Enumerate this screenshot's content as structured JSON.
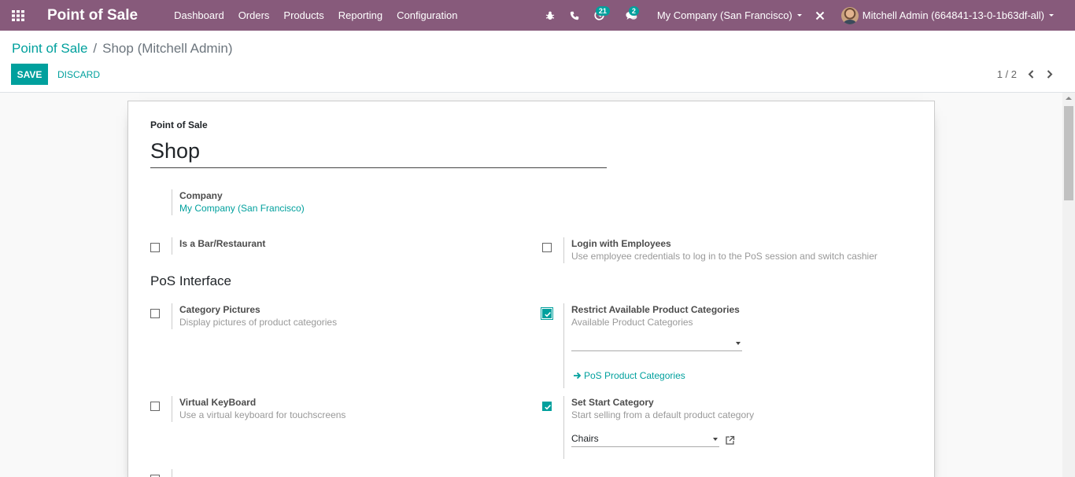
{
  "navbar": {
    "brand": "Point of Sale",
    "menu": [
      "Dashboard",
      "Orders",
      "Products",
      "Reporting",
      "Configuration"
    ],
    "activity_count": "21",
    "messages_count": "2",
    "company": "My Company (San Francisco)",
    "user": "Mitchell Admin (664841-13-0-1b63df-all)",
    "bg_color": "#875a7b"
  },
  "breadcrumb": {
    "parent": "Point of Sale",
    "separator": "/",
    "current": "Shop (Mitchell Admin)"
  },
  "toolbar": {
    "save": "SAVE",
    "discard": "DISCARD",
    "pager": "1 / 2"
  },
  "form": {
    "name_label": "Point of Sale",
    "name_value": "Shop",
    "company_label": "Company",
    "company_value": "My Company (San Francisco)",
    "is_bar": {
      "title": "Is a Bar/Restaurant",
      "checked": false
    },
    "login_employees": {
      "title": "Login with Employees",
      "desc": "Use employee credentials to log in to the PoS session and switch cashier",
      "checked": false
    },
    "section_pos_interface": "PoS Interface",
    "category_pictures": {
      "title": "Category Pictures",
      "desc": "Display pictures of product categories",
      "checked": false
    },
    "restrict_categories": {
      "title": "Restrict Available Product Categories",
      "desc": "Available Product Categories",
      "checked": true,
      "link": "PoS Product Categories"
    },
    "virtual_keyboard": {
      "title": "Virtual KeyBoard",
      "desc": "Use a virtual keyboard for touchscreens",
      "checked": false
    },
    "start_category": {
      "title": "Set Start Category",
      "desc": "Start selling from a default product category",
      "checked": true,
      "value": "Chairs"
    }
  },
  "colors": {
    "primary": "#00a09d",
    "navbar": "#875a7b"
  }
}
